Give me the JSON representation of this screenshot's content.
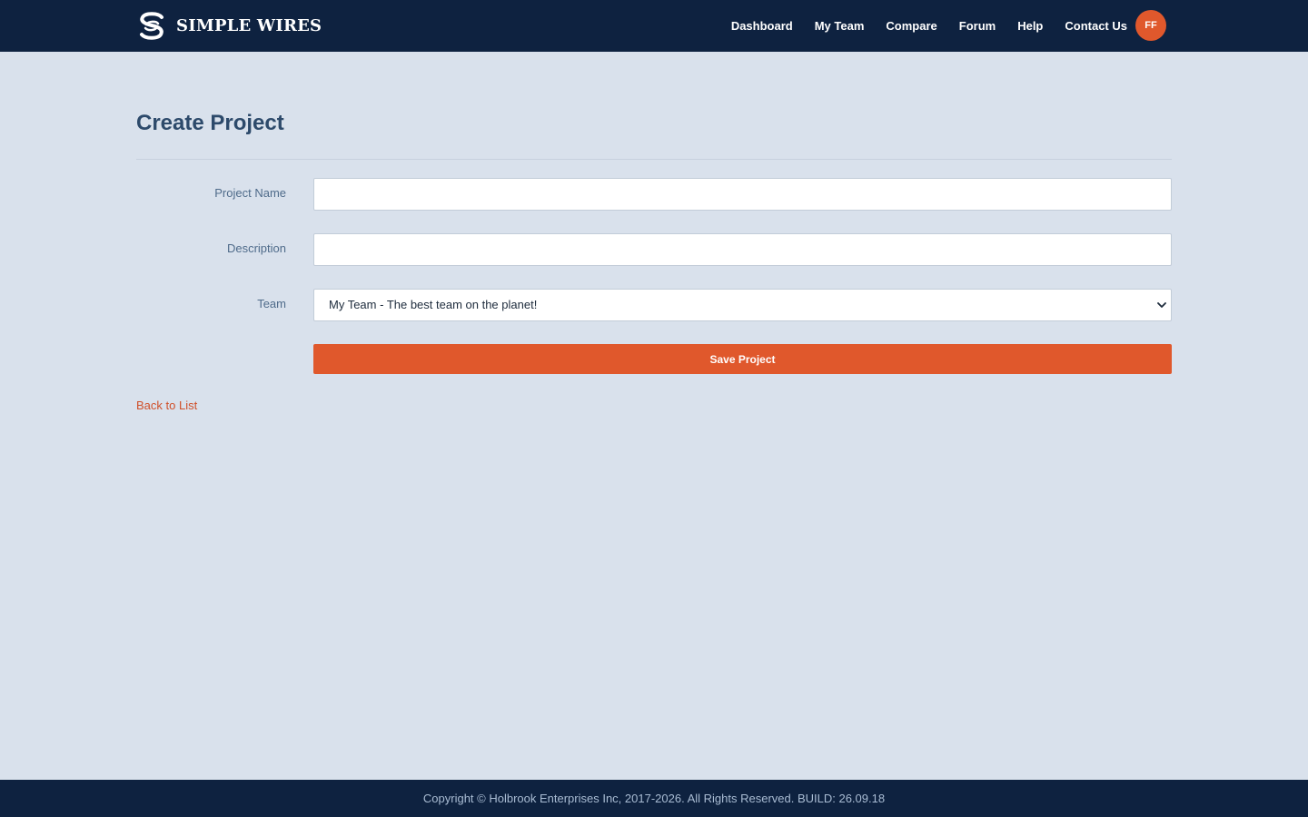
{
  "brand": {
    "name": "SIMPLE WIRES",
    "logo_icon": "brand-logo-icon"
  },
  "nav": {
    "links": [
      "Dashboard",
      "My Team",
      "Compare",
      "Forum",
      "Help",
      "Contact Us"
    ],
    "avatar_initials": "FF"
  },
  "page": {
    "title": "Create Project"
  },
  "form": {
    "project_name": {
      "label": "Project Name",
      "value": ""
    },
    "description": {
      "label": "Description",
      "value": ""
    },
    "team": {
      "label": "Team",
      "selected": "My Team - The best team on the planet!"
    },
    "save_label": "Save Project"
  },
  "back_link": "Back to List",
  "footer": {
    "text": "Copyright © Holbrook Enterprises Inc, 2017-2026. All Rights Reserved. BUILD: 26.09.18"
  },
  "colors": {
    "navbar": "#0e2240",
    "background": "#d9e1ec",
    "accent": "#e0582c",
    "heading": "#2d4a6b",
    "label": "#4f6b8a"
  }
}
